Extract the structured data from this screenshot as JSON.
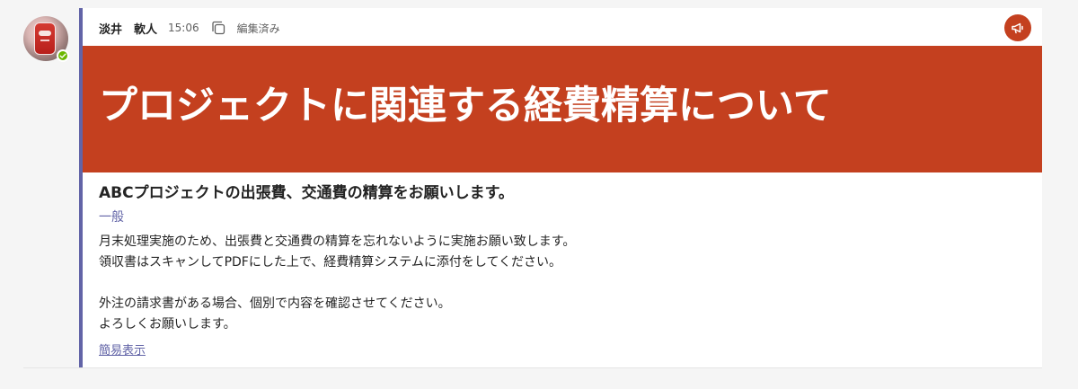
{
  "message": {
    "sender_name": "淡井　軟人",
    "timestamp": "15:06",
    "edited_label": "編集済み",
    "announcement": {
      "title": "プロジェクトに関連する経費精算について",
      "color": "#c4401f"
    },
    "subject": "ABCプロジェクトの出張費、交通費の精算をお願いします。",
    "channel": "一般",
    "body": {
      "line_1": "月末処理実施のため、出張費と交通費の精算を忘れないように実施お願い致します。",
      "line_2": "領収書はスキャンしてPDFにした上で、経費精算システムに添付をしてください。",
      "line_3": "外注の請求書がある場合、個別で内容を確認させてください。",
      "line_4": "よろしくお願いします。"
    },
    "collapse_label": "簡易表示"
  },
  "icons": {
    "copy": "copy-icon",
    "announcement": "megaphone-icon",
    "presence": "check-icon"
  },
  "colors": {
    "accent": "#6264a7",
    "presence_available": "#6bb700",
    "announcement_bg": "#c4401f"
  }
}
